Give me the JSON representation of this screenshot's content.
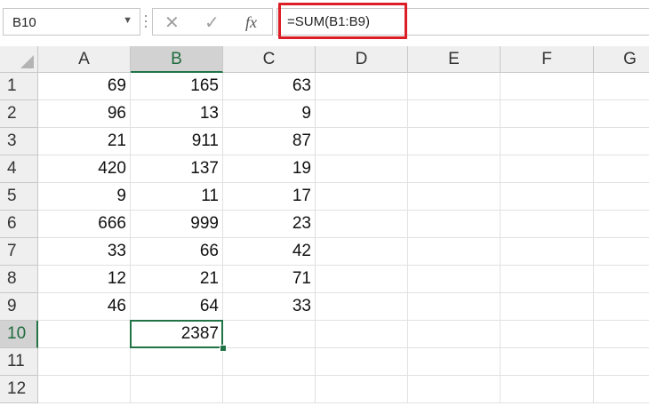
{
  "name_box": {
    "value": "B10",
    "dropdown_icon": "chevron-down-icon"
  },
  "formula_bar": {
    "cancel_glyph": "✕",
    "enter_glyph": "✓",
    "fx_label": "fx",
    "formula": "=SUM(B1:B9)",
    "highlight_color": "#dc1f26"
  },
  "grid": {
    "columns": [
      "A",
      "B",
      "C",
      "D",
      "E",
      "F",
      "G"
    ],
    "rows": [
      "1",
      "2",
      "3",
      "4",
      "5",
      "6",
      "7",
      "8",
      "9",
      "10",
      "11",
      "12"
    ],
    "selected_cell": "B10",
    "cells": [
      [
        "69",
        "165",
        "63",
        "",
        "",
        "",
        ""
      ],
      [
        "96",
        "13",
        "9",
        "",
        "",
        "",
        ""
      ],
      [
        "21",
        "911",
        "87",
        "",
        "",
        "",
        ""
      ],
      [
        "420",
        "137",
        "19",
        "",
        "",
        "",
        ""
      ],
      [
        "9",
        "11",
        "17",
        "",
        "",
        "",
        ""
      ],
      [
        "666",
        "999",
        "23",
        "",
        "",
        "",
        ""
      ],
      [
        "33",
        "66",
        "42",
        "",
        "",
        "",
        ""
      ],
      [
        "12",
        "21",
        "71",
        "",
        "",
        "",
        ""
      ],
      [
        "46",
        "64",
        "33",
        "",
        "",
        "",
        ""
      ],
      [
        "",
        "2387",
        "",
        "",
        "",
        "",
        ""
      ],
      [
        "",
        "",
        "",
        "",
        "",
        "",
        ""
      ],
      [
        "",
        "",
        "",
        "",
        "",
        "",
        ""
      ]
    ],
    "accent_color": "#217346"
  }
}
